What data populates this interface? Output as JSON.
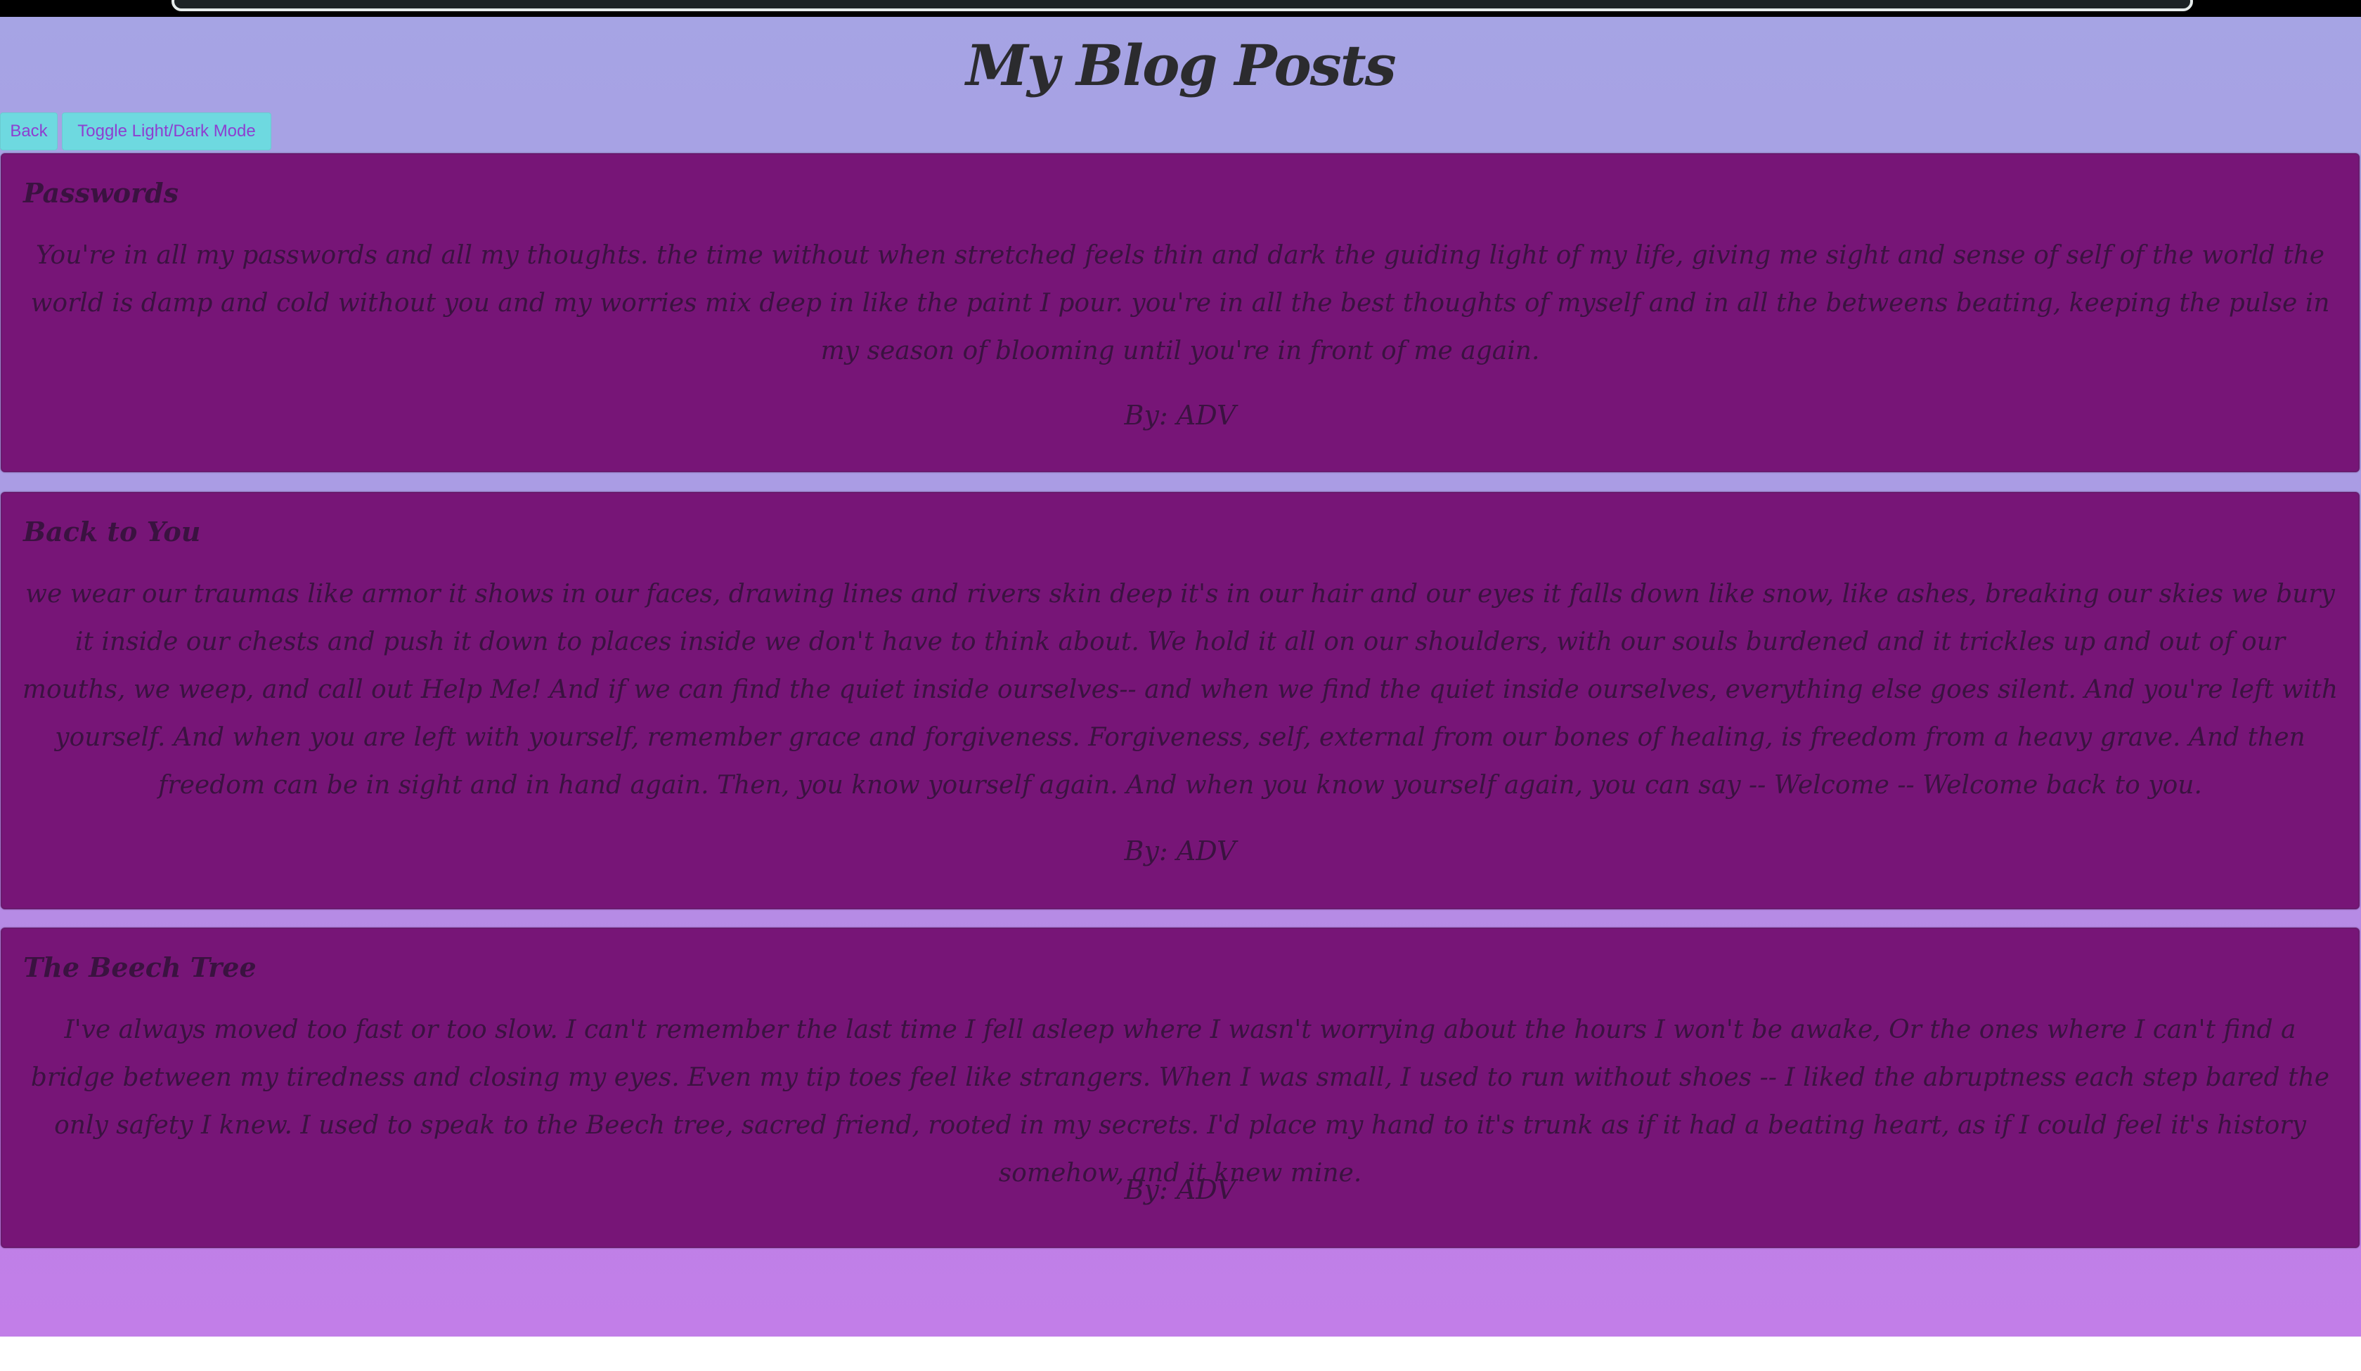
{
  "header": {
    "title": "My Blog Posts"
  },
  "toolbar": {
    "back_label": "Back",
    "toggle_label": "Toggle Light/Dark Mode"
  },
  "posts": [
    {
      "title": "Passwords",
      "body": "You're in all my passwords and all my thoughts. the time without when stretched feels thin and dark the guiding light of my life, giving me sight and sense of self of the world the world is damp and cold without you and my worries mix deep in like the paint I pour. you're in all the best thoughts of myself and in all the betweens beating, keeping the pulse in my season of blooming until you're in front of me again.",
      "author": "By: ADV"
    },
    {
      "title": "Back to You",
      "body": "we wear our traumas like armor it shows in our faces, drawing lines and rivers skin deep it's in our hair and our eyes it falls down like snow, like ashes, breaking our skies we bury it inside our chests and push it down to places inside we don't have to think about. We hold it all on our shoulders, with our souls burdened and it trickles up and out of our mouths, we weep, and call out Help Me! And if we can find the quiet inside ourselves-- and when we find the quiet inside ourselves, everything else goes silent. And you're left with yourself. And when you are left with yourself, remember grace and forgiveness. Forgiveness, self, external from our bones of healing, is freedom from a heavy grave. And then freedom can be in sight and in hand again. Then, you know yourself again. And when you know yourself again, you can say -- Welcome -- Welcome back to you.",
      "author": "By: ADV"
    },
    {
      "title": "The Beech Tree",
      "body": "I've always moved too fast or too slow. I can't remember the last time I fell asleep where I wasn't worrying about the hours I won't be awake, Or the ones where I can't find a bridge between my tiredness and closing my eyes. Even my tip toes feel like strangers. When I was small, I used to run without shoes -- I liked the abruptness each step bared the only safety I knew. I used to speak to the Beech tree, sacred friend, rooted in my secrets. I'd place my hand to it's trunk as if it had a beating heart, as if I could feel it's history somehow, and it knew mine.",
      "author": "By: ADV"
    }
  ]
}
